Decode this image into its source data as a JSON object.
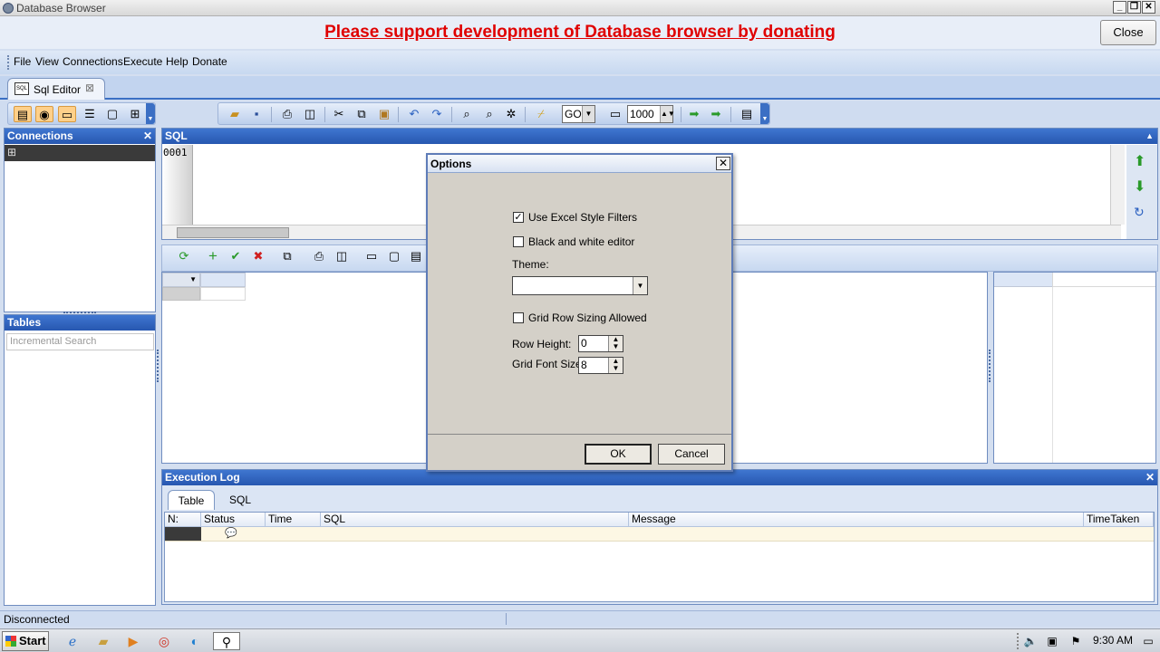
{
  "window": {
    "title": "Database Browser"
  },
  "banner": {
    "text": "Please support development of Database browser by donating",
    "close_label": "Close"
  },
  "menu": [
    "File",
    "View",
    "Connections",
    "Execute",
    "Help",
    "Donate"
  ],
  "doc_tab": {
    "label": "Sql Editor"
  },
  "toolbar": {
    "go_value": "GO",
    "limit_value": "1000"
  },
  "connections": {
    "title": "Connections"
  },
  "tables": {
    "title": "Tables",
    "search_placeholder": "Incremental Search"
  },
  "sql": {
    "title": "SQL",
    "line_number": "0001"
  },
  "exec_log": {
    "title": "Execution Log",
    "tabs": [
      "Table",
      "SQL"
    ],
    "columns": [
      "N:",
      "Status",
      "Time",
      "SQL",
      "Message",
      "TimeTaken"
    ]
  },
  "status": {
    "text": "Disconnected"
  },
  "taskbar": {
    "start": "Start",
    "clock": "9:30 AM"
  },
  "dialog": {
    "title": "Options",
    "excel_filters_label": "Use Excel Style Filters",
    "excel_filters_checked": true,
    "bw_editor_label": "Black and white editor",
    "bw_editor_checked": false,
    "theme_label": "Theme:",
    "theme_value": "",
    "row_sizing_label": "Grid Row Sizing Allowed",
    "row_sizing_checked": false,
    "row_height_label": "Row Height:",
    "row_height_value": "0",
    "font_size_label": "Grid Font Size:",
    "font_size_value": "8",
    "ok_label": "OK",
    "cancel_label": "Cancel"
  }
}
